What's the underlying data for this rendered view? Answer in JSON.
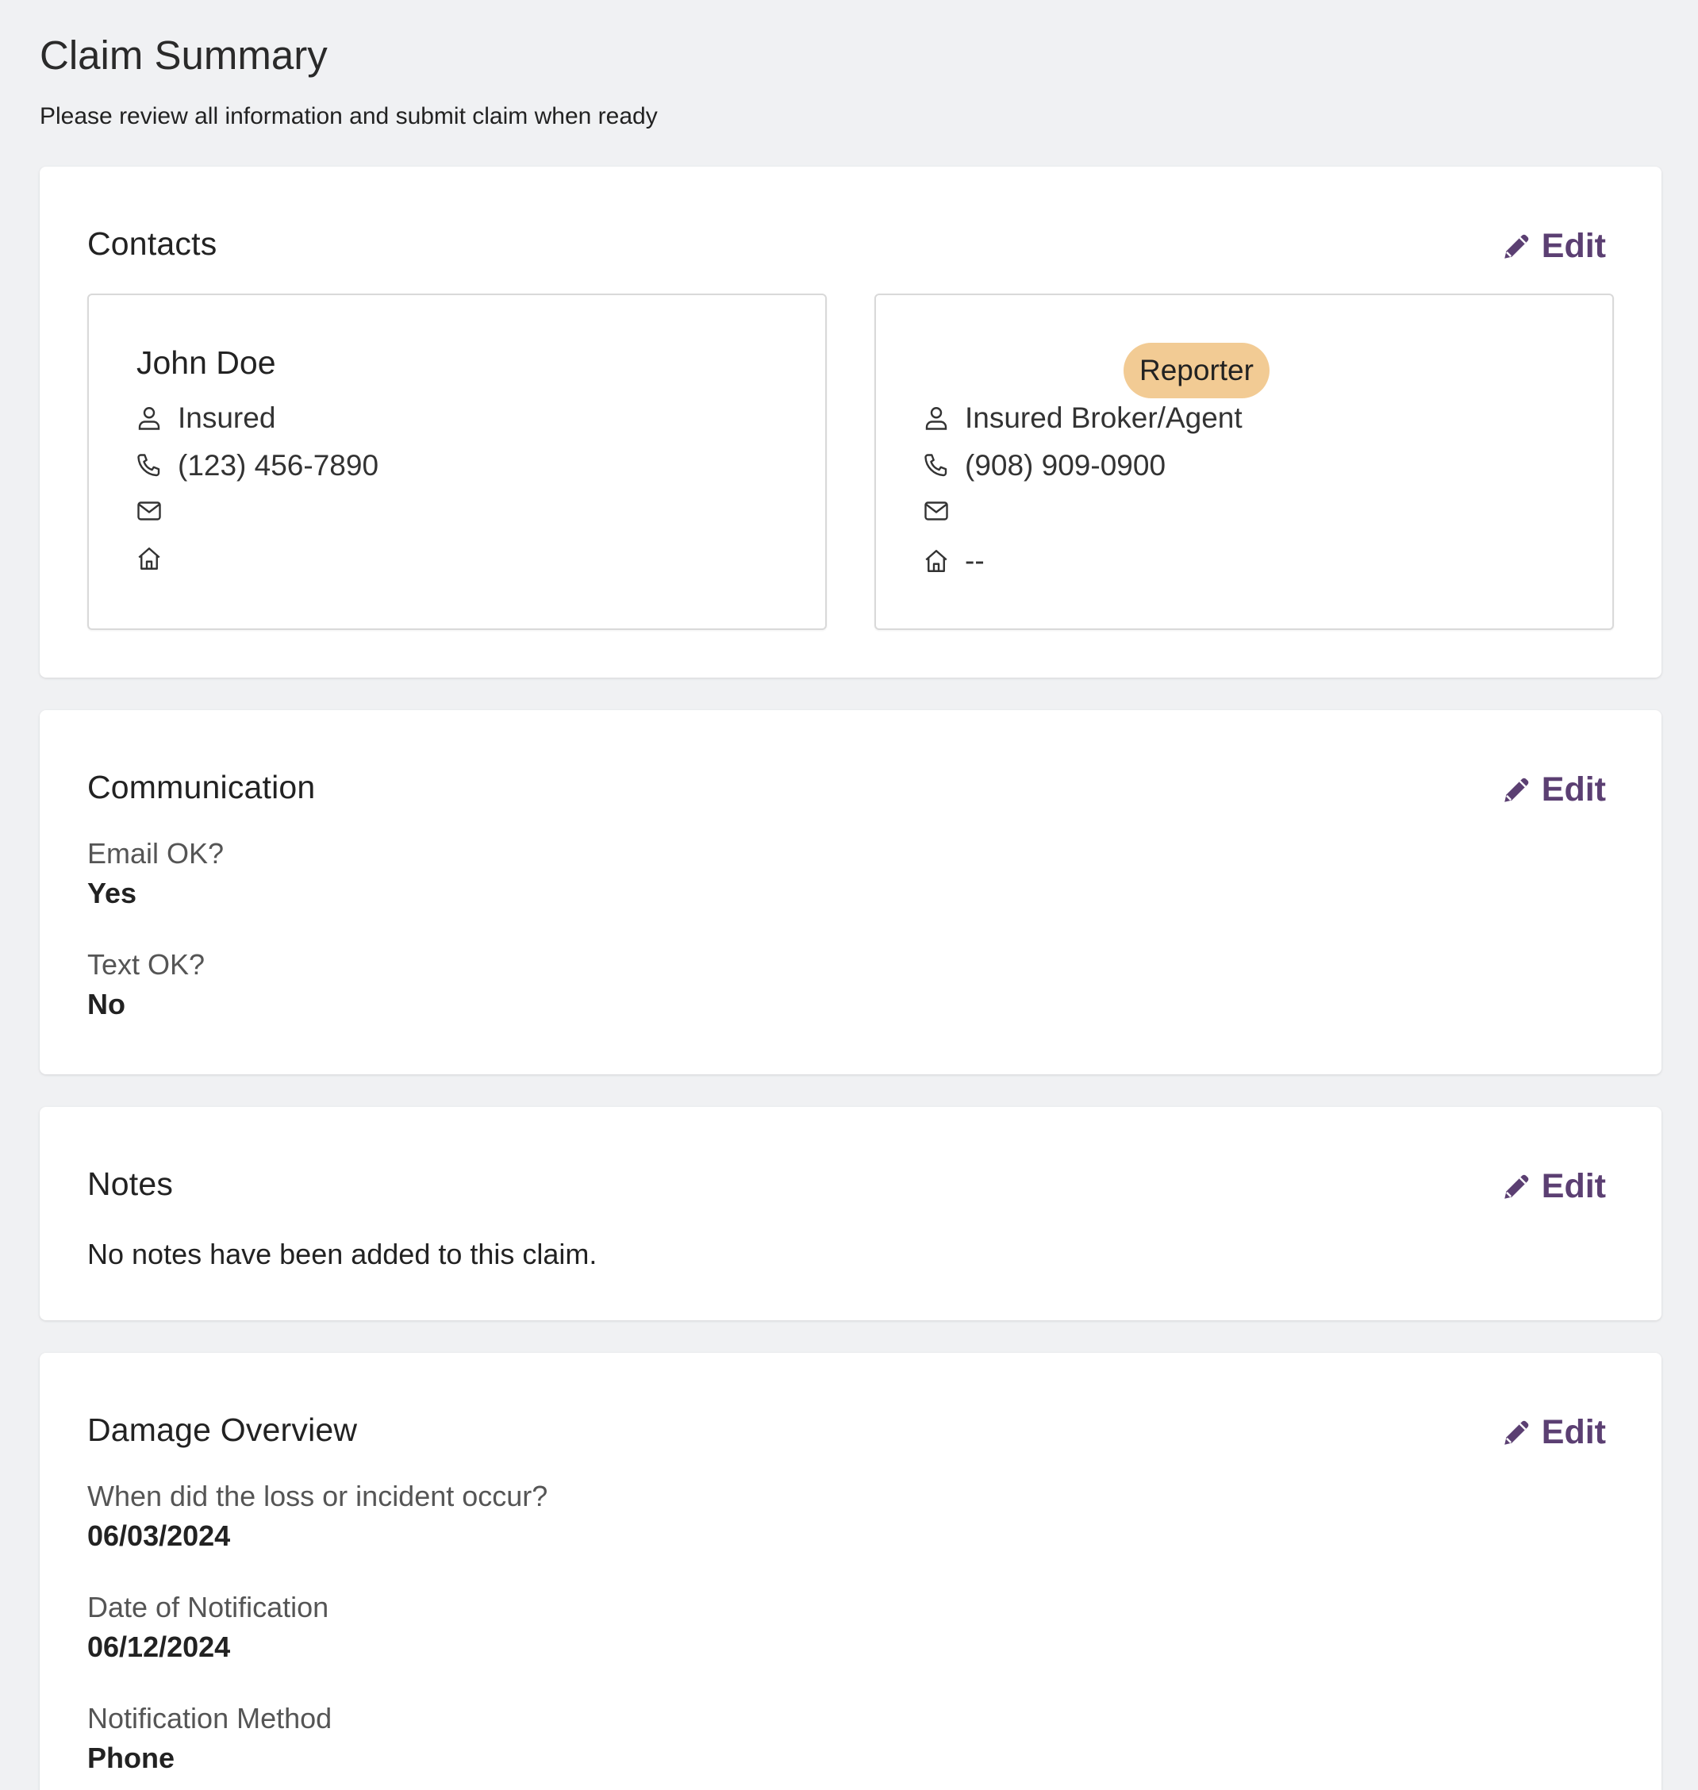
{
  "page": {
    "title": "Claim Summary",
    "subtitle": "Please review all information and submit claim when ready"
  },
  "colors": {
    "background": "#f0f1f3",
    "card": "#ffffff",
    "accent": "#5b3f72",
    "badge": "#f2cb94"
  },
  "edit_label": "Edit",
  "contacts": {
    "title": "Contacts",
    "items": [
      {
        "name": "John Doe",
        "role": "Insured",
        "phone": "(123) 456-7890",
        "email": "",
        "address": ""
      },
      {
        "badge": "Reporter",
        "role": "Insured Broker/Agent",
        "phone": "(908) 909-0900",
        "email": "",
        "address": "--"
      }
    ],
    "icons": [
      "person-icon",
      "phone-icon",
      "envelope-icon",
      "home-icon"
    ]
  },
  "communication": {
    "title": "Communication",
    "fields": [
      {
        "label": "Email OK?",
        "value": "Yes"
      },
      {
        "label": "Text OK?",
        "value": "No"
      }
    ]
  },
  "notes": {
    "title": "Notes",
    "text": "No notes have been added to this claim."
  },
  "damage_overview": {
    "title": "Damage Overview",
    "fields": [
      {
        "label": "When did the loss or incident occur?",
        "value": "06/03/2024"
      },
      {
        "label": "Date of Notification",
        "value": "06/12/2024"
      },
      {
        "label": "Notification Method",
        "value": "Phone"
      }
    ]
  }
}
